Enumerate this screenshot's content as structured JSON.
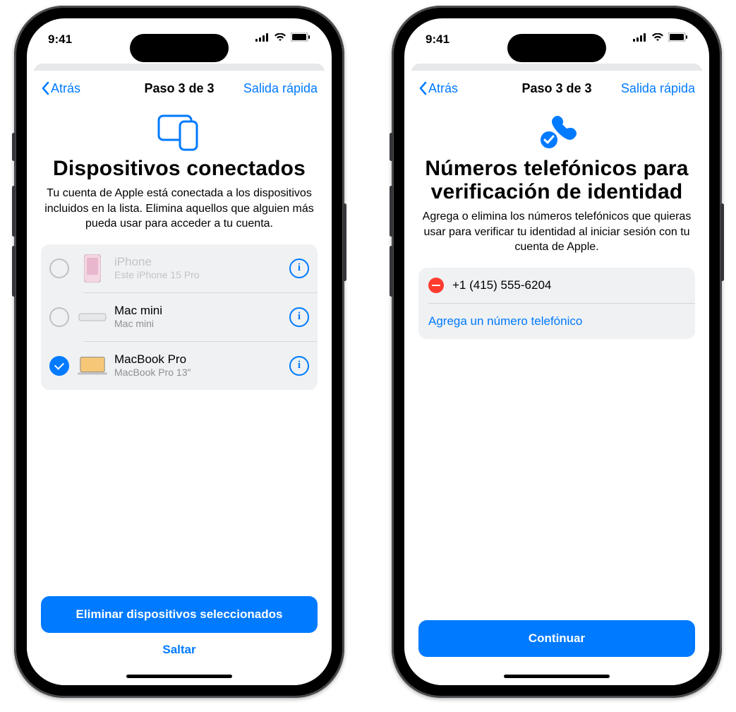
{
  "status": {
    "time": "9:41"
  },
  "nav": {
    "back": "Atrás",
    "step": "Paso 3 de 3",
    "quick": "Salida rápida"
  },
  "devices": {
    "title": "Dispositivos conectados",
    "desc": "Tu cuenta de Apple está conectada a los dispositivos incluidos en la lista. Elimina aquellos que alguien más pueda usar para acceder a tu cuenta.",
    "items": [
      {
        "name": "iPhone",
        "sub": "Este iPhone 15 Pro",
        "selected": false,
        "dim": true
      },
      {
        "name": "Mac mini",
        "sub": "Mac mini",
        "selected": false,
        "dim": false
      },
      {
        "name": "MacBook Pro",
        "sub": "MacBook Pro 13\"",
        "selected": true,
        "dim": false
      }
    ],
    "primary": "Eliminar dispositivos seleccionados",
    "skip": "Saltar"
  },
  "phones": {
    "title": "Números telefónicos para verificación de identidad",
    "desc": "Agrega o elimina los números telefónicos que quieras usar para verificar tu identidad al iniciar sesión con tu cuenta de Apple.",
    "number": "+1 (415) 555-6204",
    "add": "Agrega un número telefónico",
    "primary": "Continuar"
  }
}
